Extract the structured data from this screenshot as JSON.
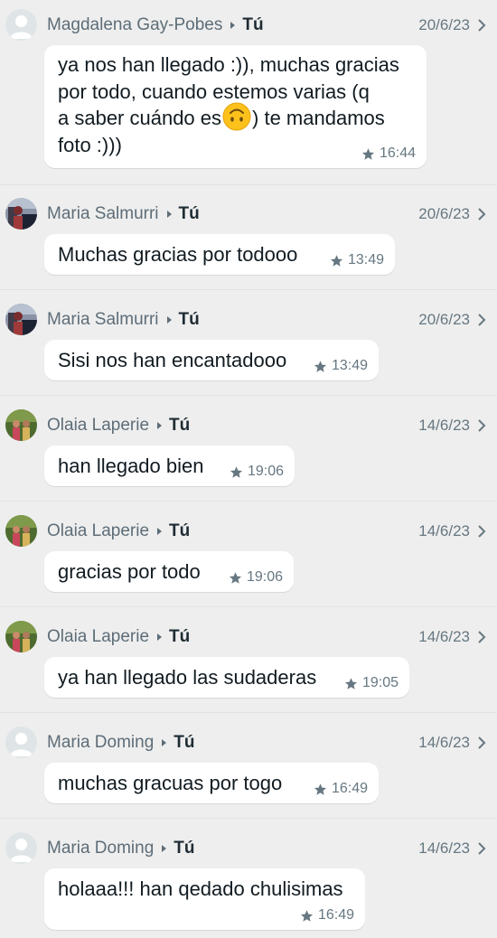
{
  "recipient_label": "Tú",
  "messages": [
    {
      "sender": "Magdalena Gay-Pobes",
      "avatar": "default-avatar",
      "date": "20/6/23",
      "lines": [
        "ya nos han llegado :)), muchas gracias",
        "por todo, cuando estemos varias (q",
        "a saber cuándo es",
        "foto :)))"
      ],
      "line3_suffix": ") te mandamos",
      "emoji": "upside-down-face-emoji",
      "time": "16:44"
    },
    {
      "sender": "Maria Salmurri",
      "avatar": "photo-avatar-maria-salmurri",
      "date": "20/6/23",
      "text": "Muchas gracias por todooo",
      "time": "13:49"
    },
    {
      "sender": "Maria Salmurri",
      "avatar": "photo-avatar-maria-salmurri",
      "date": "20/6/23",
      "text": "Sisi nos han encantadooo",
      "time": "13:49"
    },
    {
      "sender": "Olaia Laperie",
      "avatar": "photo-avatar-olaia-laperie",
      "date": "14/6/23",
      "text": "han llegado bien",
      "time": "19:06"
    },
    {
      "sender": "Olaia Laperie",
      "avatar": "photo-avatar-olaia-laperie",
      "date": "14/6/23",
      "text": "gracias por todo",
      "time": "19:06"
    },
    {
      "sender": "Olaia Laperie",
      "avatar": "photo-avatar-olaia-laperie",
      "date": "14/6/23",
      "text": "ya han llegado las sudaderas",
      "time": "19:05"
    },
    {
      "sender": "Maria Doming",
      "avatar": "default-avatar",
      "date": "14/6/23",
      "text": "muchas gracuas por togo",
      "time": "16:49"
    },
    {
      "sender": "Maria Doming",
      "avatar": "default-avatar",
      "date": "14/6/23",
      "text": "holaaa!!! han qedado chulisimas",
      "time": "16:49"
    }
  ],
  "colors": {
    "background": "#eeeeee",
    "bubble": "#ffffff",
    "sender_text": "#5d6d78",
    "recipient_text": "#1f2c34",
    "message_text": "#111b21",
    "meta_text": "#667781"
  }
}
